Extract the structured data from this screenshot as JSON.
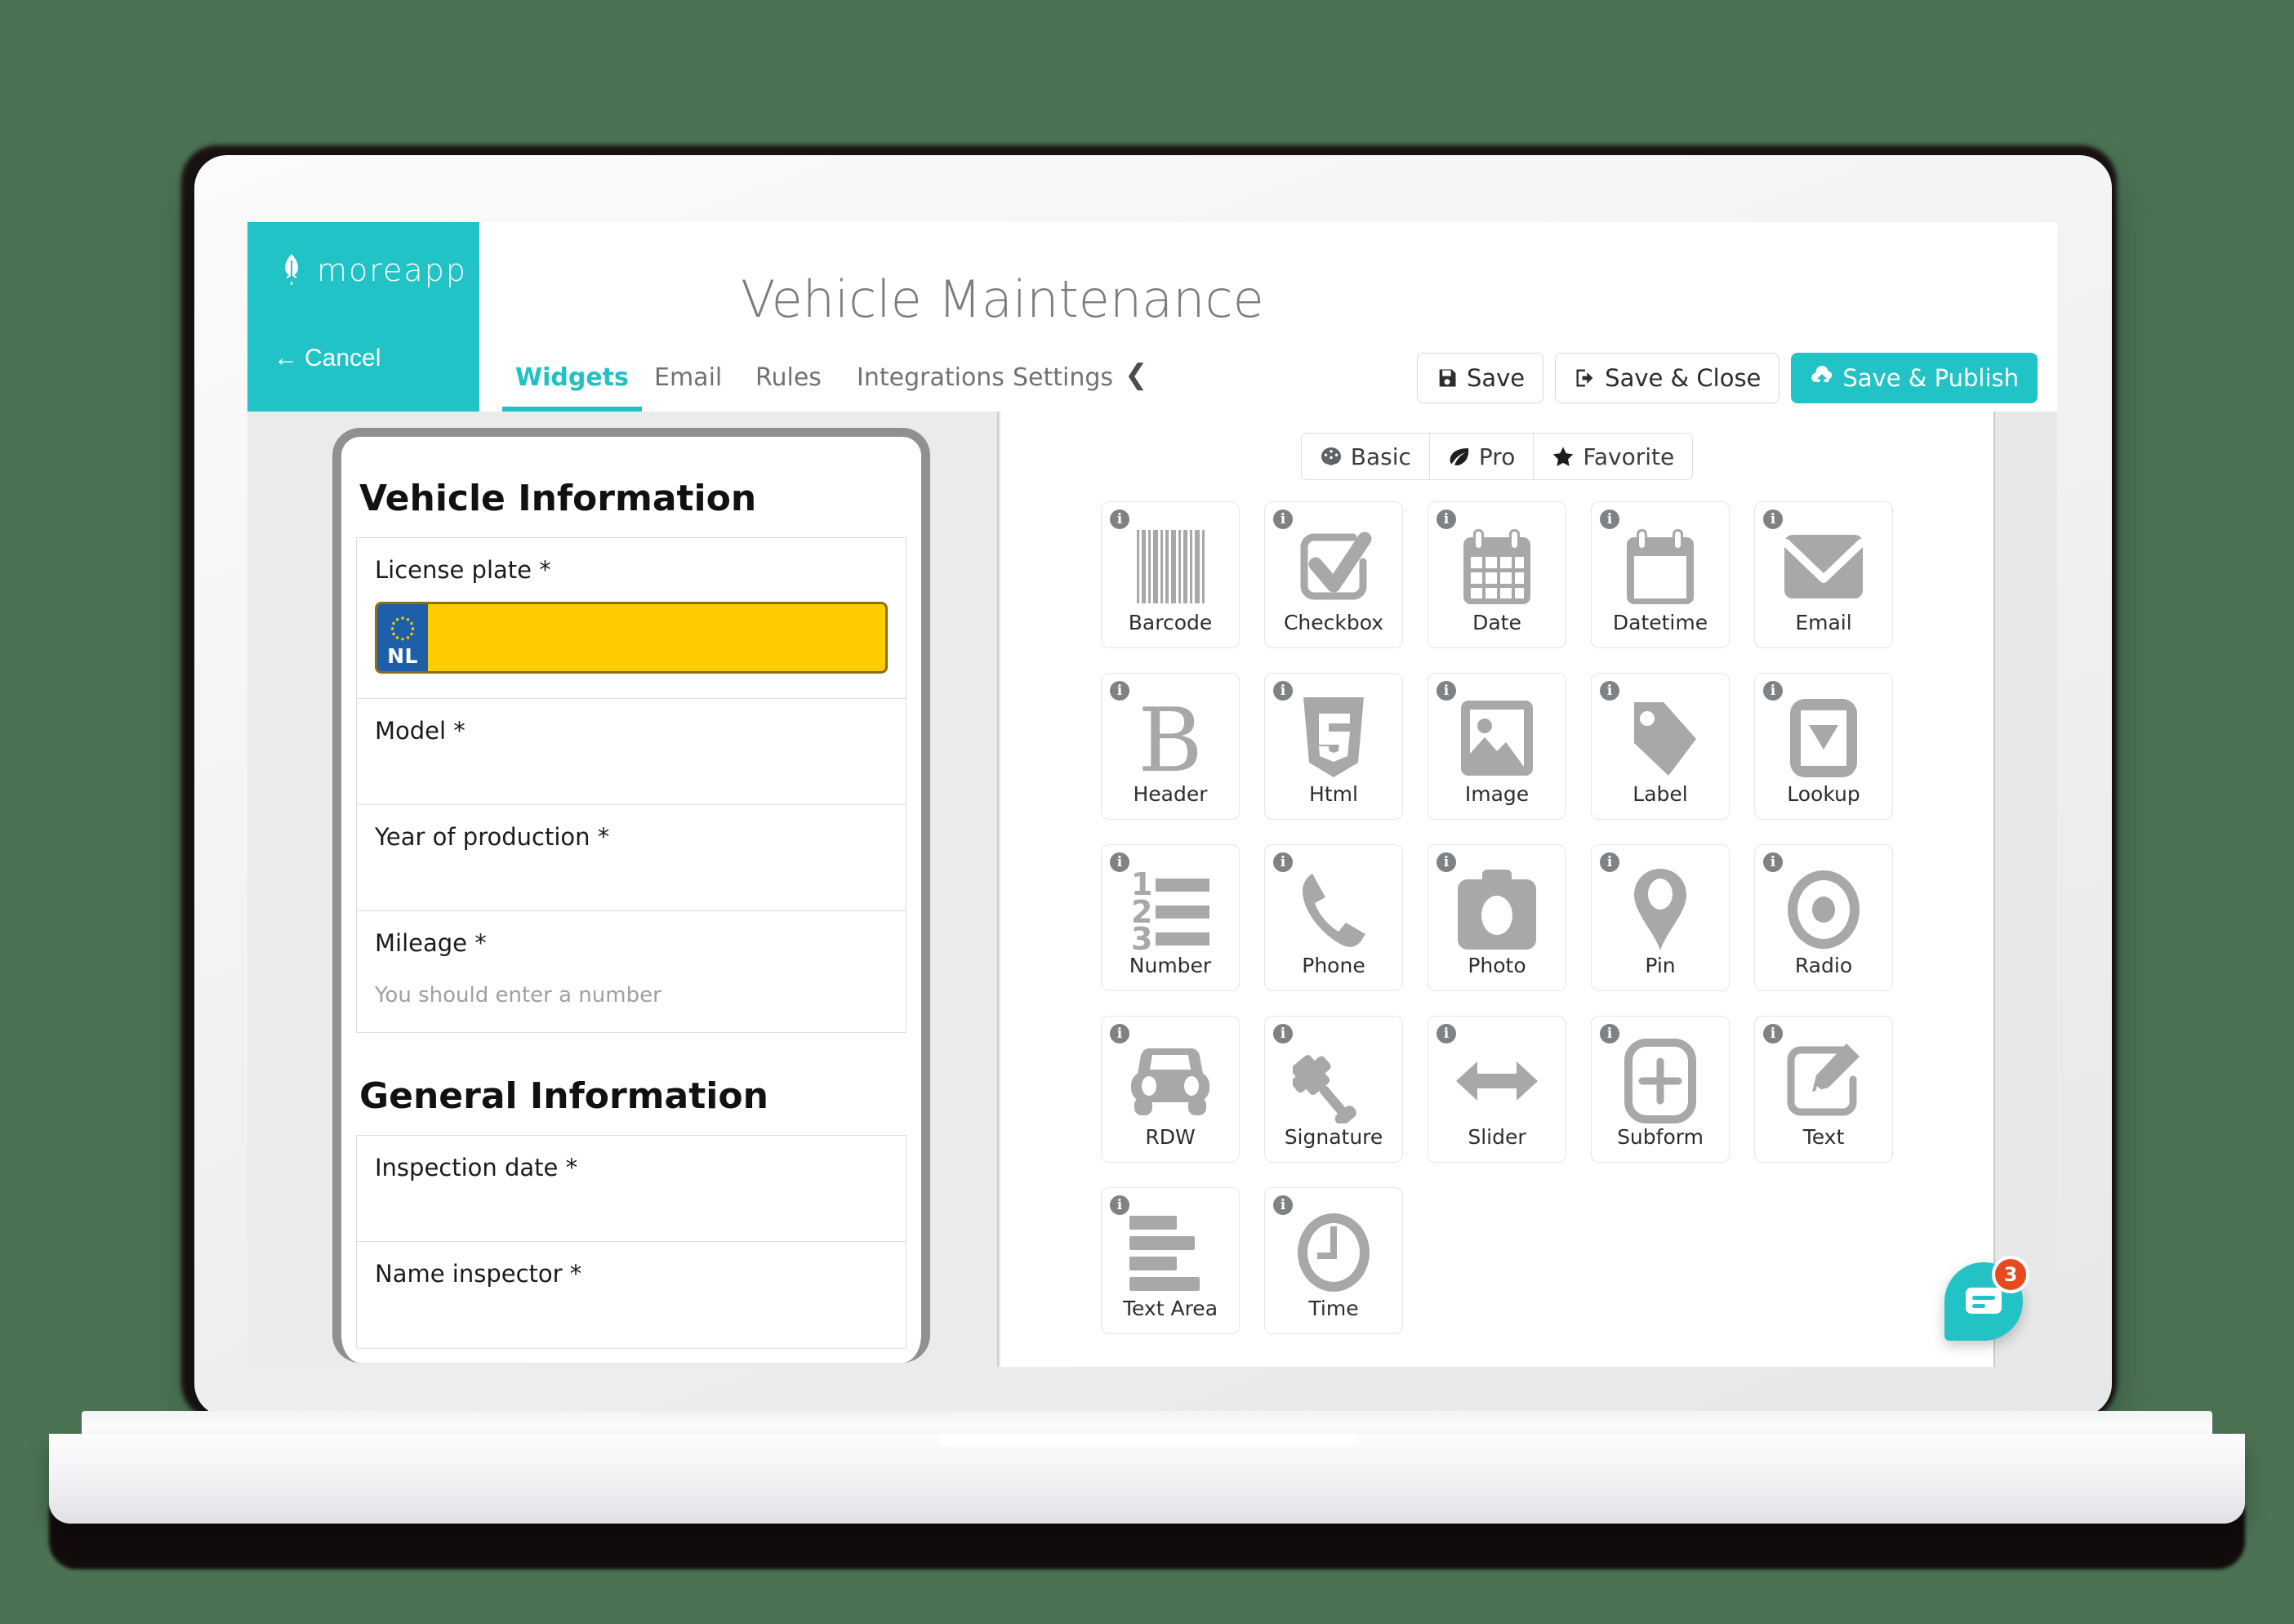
{
  "brand": {
    "name": "moreapp",
    "logo_icon": "leaf-icon",
    "cancel_label": "Cancel",
    "accent_color": "#22c3c6"
  },
  "header": {
    "title": "Vehicle Maintenance"
  },
  "tabs": [
    {
      "label": "Widgets",
      "active": true
    },
    {
      "label": "Email",
      "active": false
    },
    {
      "label": "Rules",
      "active": false
    },
    {
      "label": "Integrations",
      "active": false
    },
    {
      "label": "Settings",
      "active": false
    }
  ],
  "tab_collapse_icon": "chevron-left-icon",
  "actions": [
    {
      "label": "Save",
      "icon": "floppy-disk-icon",
      "style": "default"
    },
    {
      "label": "Save & Close",
      "icon": "sign-out-icon",
      "style": "default"
    },
    {
      "label": "Save & Publish",
      "icon": "cloud-upload-icon",
      "style": "primary"
    }
  ],
  "preview": {
    "sections": [
      {
        "heading": "Vehicle Information",
        "fields": [
          {
            "label": "License plate *",
            "type": "license-plate",
            "plate_country": "NL",
            "plate_color": "#ffcc00",
            "hint": ""
          },
          {
            "label": "Model *",
            "type": "text",
            "hint": ""
          },
          {
            "label": "Year of production *",
            "type": "text",
            "hint": ""
          },
          {
            "label": "Mileage *",
            "type": "number",
            "hint": "You should enter a number"
          }
        ]
      },
      {
        "heading": "General Information",
        "fields": [
          {
            "label": "Inspection date *",
            "type": "date",
            "hint": ""
          },
          {
            "label": "Name inspector *",
            "type": "text",
            "hint": ""
          }
        ]
      }
    ]
  },
  "widget_filters": [
    {
      "label": "Basic",
      "icon": "brain-icon",
      "active": true
    },
    {
      "label": "Pro",
      "icon": "leaf-icon",
      "active": false
    },
    {
      "label": "Favorite",
      "icon": "star-icon",
      "active": false
    }
  ],
  "widgets": [
    {
      "label": "Barcode",
      "icon": "barcode-icon"
    },
    {
      "label": "Checkbox",
      "icon": "checkbox-icon"
    },
    {
      "label": "Date",
      "icon": "calendar-icon"
    },
    {
      "label": "Datetime",
      "icon": "calendar-blank-icon"
    },
    {
      "label": "Email",
      "icon": "envelope-icon"
    },
    {
      "label": "Header",
      "icon": "bold-b-icon"
    },
    {
      "label": "Html",
      "icon": "html5-icon"
    },
    {
      "label": "Image",
      "icon": "picture-icon"
    },
    {
      "label": "Label",
      "icon": "tag-icon"
    },
    {
      "label": "Lookup",
      "icon": "dropdown-icon"
    },
    {
      "label": "Number",
      "icon": "ordered-list-icon"
    },
    {
      "label": "Phone",
      "icon": "phone-icon"
    },
    {
      "label": "Photo",
      "icon": "camera-icon"
    },
    {
      "label": "Pin",
      "icon": "map-pin-icon"
    },
    {
      "label": "Radio",
      "icon": "radio-button-icon"
    },
    {
      "label": "RDW",
      "icon": "car-icon"
    },
    {
      "label": "Signature",
      "icon": "gavel-icon"
    },
    {
      "label": "Slider",
      "icon": "arrows-horizontal-icon"
    },
    {
      "label": "Subform",
      "icon": "plus-square-icon"
    },
    {
      "label": "Text",
      "icon": "pencil-square-icon"
    },
    {
      "label": "Text Area",
      "icon": "align-left-icon"
    },
    {
      "label": "Time",
      "icon": "clock-icon"
    }
  ],
  "widget_info_icon": "info-icon",
  "chat": {
    "icon": "chat-bubble-icon",
    "badge": "3",
    "badge_color": "#e8491f"
  }
}
